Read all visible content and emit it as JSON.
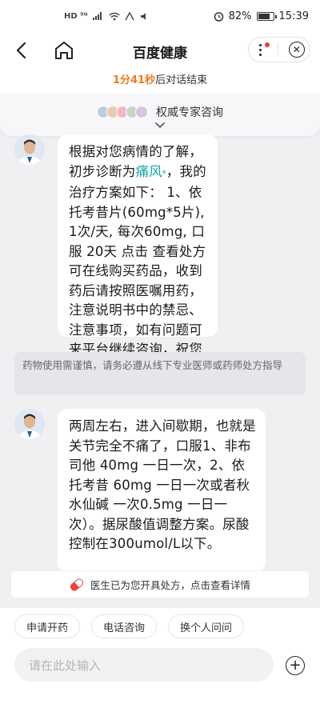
{
  "status": {
    "left_indicators": "HD ⁵ᴳ",
    "right_time": "15:39",
    "battery_text": "82%"
  },
  "nav": {
    "title": "百度健康"
  },
  "timer": {
    "count": "1分41秒",
    "suffix": "后对话结束"
  },
  "expert": {
    "label": "权威专家咨询"
  },
  "messages": [
    {
      "pre": "根据对您病情的了解，初步诊断为",
      "link": "痛风",
      "link_mark": "ᵠ",
      "post": "，我的治疗方案如下： 1、依托考昔片(60mg*5片), 1次/天, 每次60mg, 口服 20天 点击 查看处方 可在线购买药品，收到药后请按照医嘱用药，注意说明书中的禁忌、注意事项，如有问题可来平台继续咨询，祝您早日康复"
    },
    {
      "text": "两周左右，进入间歇期，也就是关节完全不痛了，口服1、非布司他 40mg 一日一次，2、依托考昔 60mg 一日一次或者秋水仙碱 一次0.5mg 一日一次）。据尿酸值调整方案。尿酸控制在300umol/L以下。"
    }
  ],
  "notice": "药物使用需谨慎，请务必遵从线下专业医师或药师处方指导",
  "rx_strip": "医生已为您开具处方，点击查看详情",
  "chips": [
    "申请开药",
    "电话咨询",
    "换个人问问"
  ],
  "input": {
    "placeholder": "请在此处输入"
  },
  "colors": {
    "accent_orange": "#f07b1d",
    "link_teal": "#12a6a0",
    "badge_red": "#f23b3b"
  }
}
